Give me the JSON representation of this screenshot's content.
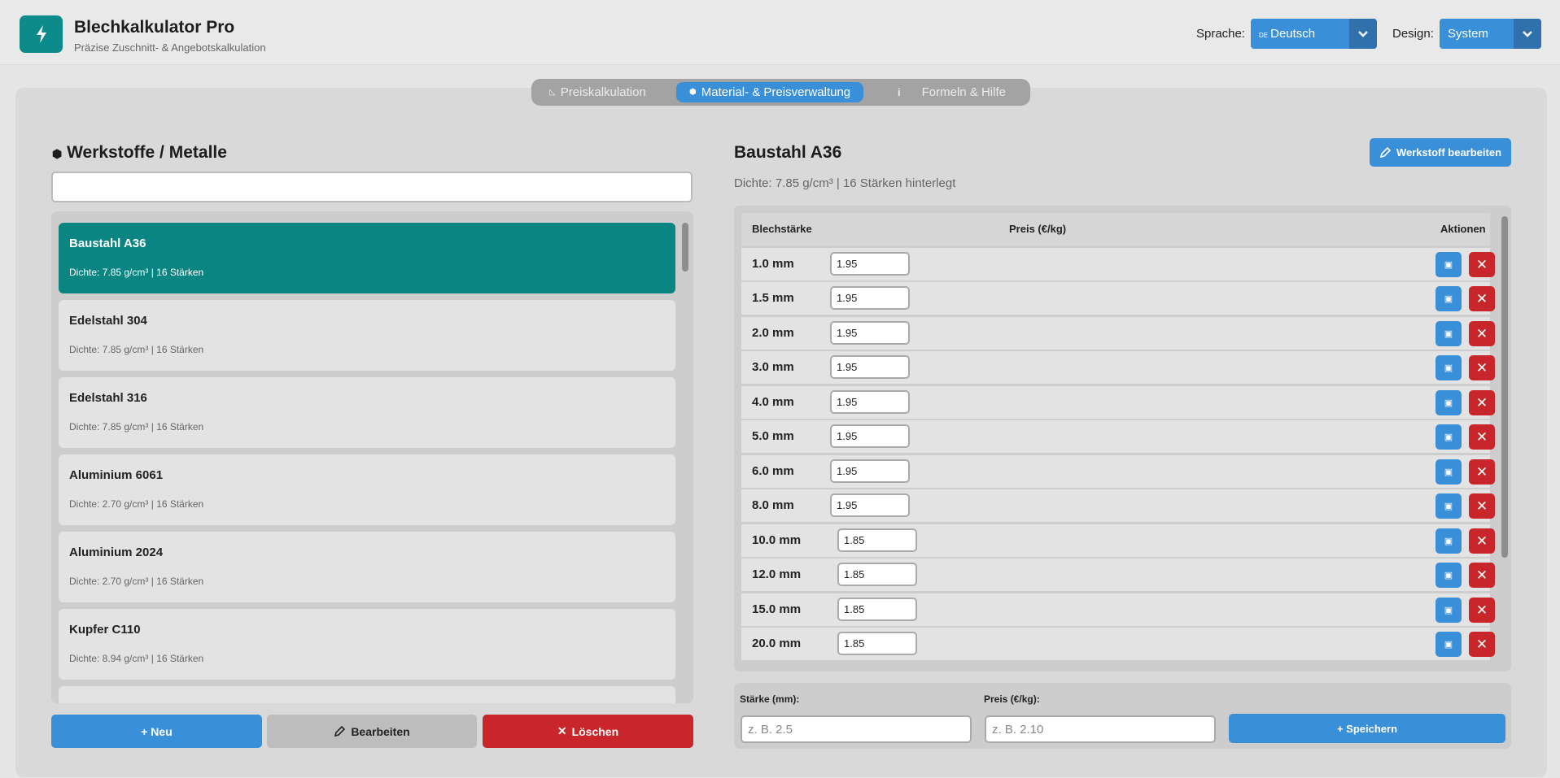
{
  "app": {
    "title": "Blechkalkulator Pro",
    "subtitle": "Präzise Zuschnitt- & Angebotskalkulation",
    "language_label": "Sprache:",
    "language_flag": "DE",
    "language_value": "Deutsch",
    "theme_label": "Design:",
    "theme_value": "System",
    "accent_color": "#3a8fd9",
    "brand_color": "#0d8a8a",
    "danger_color": "#c8262a"
  },
  "tabs": [
    {
      "label": "Preiskalkulation",
      "icon": "ruler-triangle-icon",
      "active": false
    },
    {
      "label": "Material- & Preisverwaltung",
      "icon": "box-icon",
      "active": true
    },
    {
      "label": "Formeln & Hilfe",
      "icon": "info-icon",
      "active": false
    }
  ],
  "materials_panel": {
    "title": "Werkstoffe / Metalle",
    "search_value": "",
    "items": [
      {
        "name": "Baustahl A36",
        "meta": "Dichte: 7.85 g/cm³ | 16 Stärken",
        "selected": true
      },
      {
        "name": "Edelstahl 304",
        "meta": "Dichte: 7.85 g/cm³ | 16 Stärken",
        "selected": false
      },
      {
        "name": "Edelstahl 316",
        "meta": "Dichte: 7.85 g/cm³ | 16 Stärken",
        "selected": false
      },
      {
        "name": "Aluminium 6061",
        "meta": "Dichte: 2.70 g/cm³ | 16 Stärken",
        "selected": false
      },
      {
        "name": "Aluminium 2024",
        "meta": "Dichte: 2.70 g/cm³ | 16 Stärken",
        "selected": false
      },
      {
        "name": "Kupfer C110",
        "meta": "Dichte: 8.94 g/cm³ | 16 Stärken",
        "selected": false
      }
    ],
    "new_label": "+ Neu",
    "edit_label": "Bearbeiten",
    "delete_label": "Löschen"
  },
  "detail": {
    "title": "Baustahl A36",
    "subtitle": "Dichte: 7.85 g/cm³ | 16 Stärken hinterlegt",
    "edit_label": "Werkstoff bearbeiten",
    "headers": {
      "thickness": "Blechstärke",
      "price": "Preis (€/kg)",
      "actions": "Aktionen"
    },
    "rows": [
      {
        "thickness": "1.0 mm",
        "price": "1.95"
      },
      {
        "thickness": "1.5 mm",
        "price": "1.95"
      },
      {
        "thickness": "2.0 mm",
        "price": "1.95"
      },
      {
        "thickness": "3.0 mm",
        "price": "1.95"
      },
      {
        "thickness": "4.0 mm",
        "price": "1.95"
      },
      {
        "thickness": "5.0 mm",
        "price": "1.95"
      },
      {
        "thickness": "6.0 mm",
        "price": "1.95"
      },
      {
        "thickness": "8.0 mm",
        "price": "1.95"
      },
      {
        "thickness": "10.0 mm",
        "price": "1.85"
      },
      {
        "thickness": "12.0 mm",
        "price": "1.85"
      },
      {
        "thickness": "15.0 mm",
        "price": "1.85"
      },
      {
        "thickness": "20.0 mm",
        "price": "1.85"
      }
    ],
    "add": {
      "thickness_label": "Stärke (mm):",
      "thickness_placeholder": "z. B. 2.5",
      "price_label": "Preis (€/kg):",
      "price_placeholder": "z. B. 2.10",
      "save_label": "+ Speichern"
    }
  }
}
